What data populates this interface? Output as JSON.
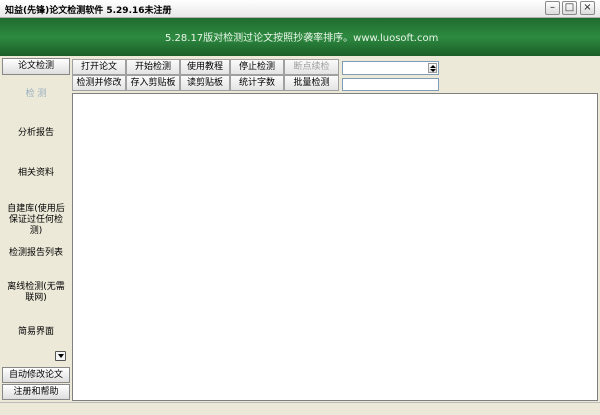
{
  "window": {
    "title": "知益(先锋)论文检测软件 5.29.16未注册",
    "controls": {
      "minimize": "–",
      "maximize": "□",
      "close": "×"
    }
  },
  "banner": {
    "message": "5.28.17版对检测过论文按照抄袭率排序。www.luosoft.com",
    "color": "#2e8a40"
  },
  "sidebar": {
    "top_button": "论文检测",
    "items": [
      {
        "label": "检 测",
        "disabled": true
      },
      {
        "label": "分析报告"
      },
      {
        "label": "相关资料"
      },
      {
        "label": "自建库(使用后保证过任何检测)"
      },
      {
        "label": "检测报告列表"
      },
      {
        "label": "离线检测(无需联网)"
      },
      {
        "label": "简易界面"
      }
    ],
    "bottom_buttons": [
      "自动修改论文",
      "注册和帮助"
    ]
  },
  "toolbar": {
    "row1": [
      "打开论文",
      "开始检测",
      "使用教程",
      "停止检测",
      "断点续检"
    ],
    "row2": [
      "检测并修改",
      "存入剪贴板",
      "读剪贴板",
      "统计字数",
      "批量检测"
    ],
    "combo_value": "",
    "text_value": ""
  }
}
